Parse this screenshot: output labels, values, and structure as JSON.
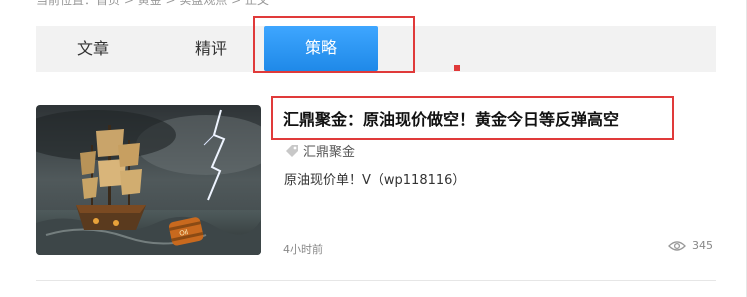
{
  "breadcrumb": "当前位置：首页 > 黄金 > 实盘观点 > 正文",
  "tabs": [
    {
      "label": "文章"
    },
    {
      "label": "精评"
    },
    {
      "label": "策略"
    }
  ],
  "article": {
    "title": "汇鼎聚金：原油现价做空！黄金今日等反弹高空",
    "source": "汇鼎聚金",
    "summary": "原油现价单！V（wp118116）",
    "time": "4小时前",
    "views": "345",
    "thumbnail": "ship-in-storm-with-oil-barrel"
  },
  "icons": {
    "source": "tag-icon",
    "views": "eye-icon"
  },
  "colors": {
    "active_tab": "#2b93f0",
    "highlight_box": "#e03a3a",
    "tab_bar_bg": "#f2f2f2"
  }
}
